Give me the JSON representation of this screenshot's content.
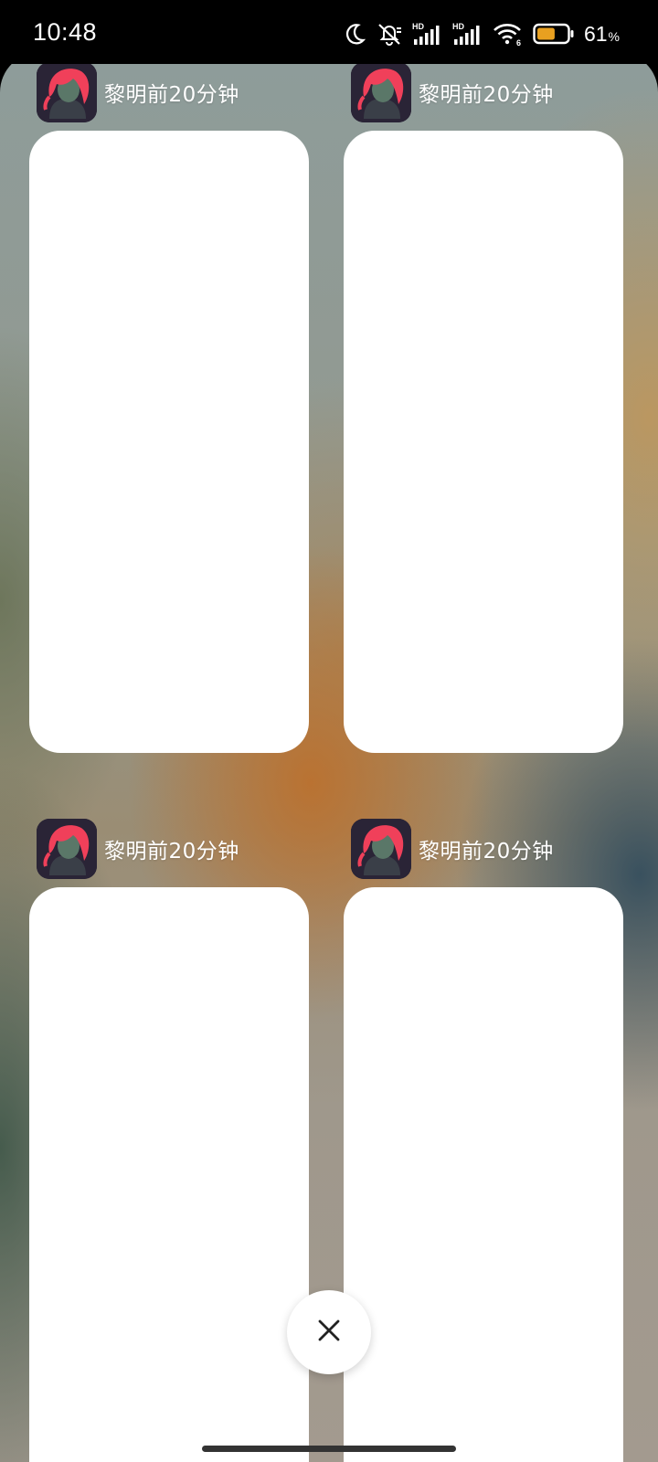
{
  "status_bar": {
    "time": "10:48",
    "battery_percent": "61",
    "battery_percent_sign": "%",
    "battery_level": 0.61,
    "network_1": "HD",
    "network_2": "HD",
    "wifi_badge": "6",
    "icons": [
      "moon-icon",
      "alarm-off-icon",
      "signal-hd-icon",
      "signal-hd-icon",
      "wifi-6-icon",
      "battery-icon"
    ]
  },
  "recents": {
    "cards": [
      {
        "app_name": "黎明前20分钟",
        "icon": "app-icon"
      },
      {
        "app_name": "黎明前20分钟",
        "icon": "app-icon"
      },
      {
        "app_name": "黎明前20分钟",
        "icon": "app-icon"
      },
      {
        "app_name": "黎明前20分钟",
        "icon": "app-icon"
      }
    ],
    "close_all_icon": "close-icon"
  },
  "colors": {
    "battery_fill": "#e8a020",
    "card_bg": "#ffffff",
    "app_icon_hair": "#f0405a"
  }
}
